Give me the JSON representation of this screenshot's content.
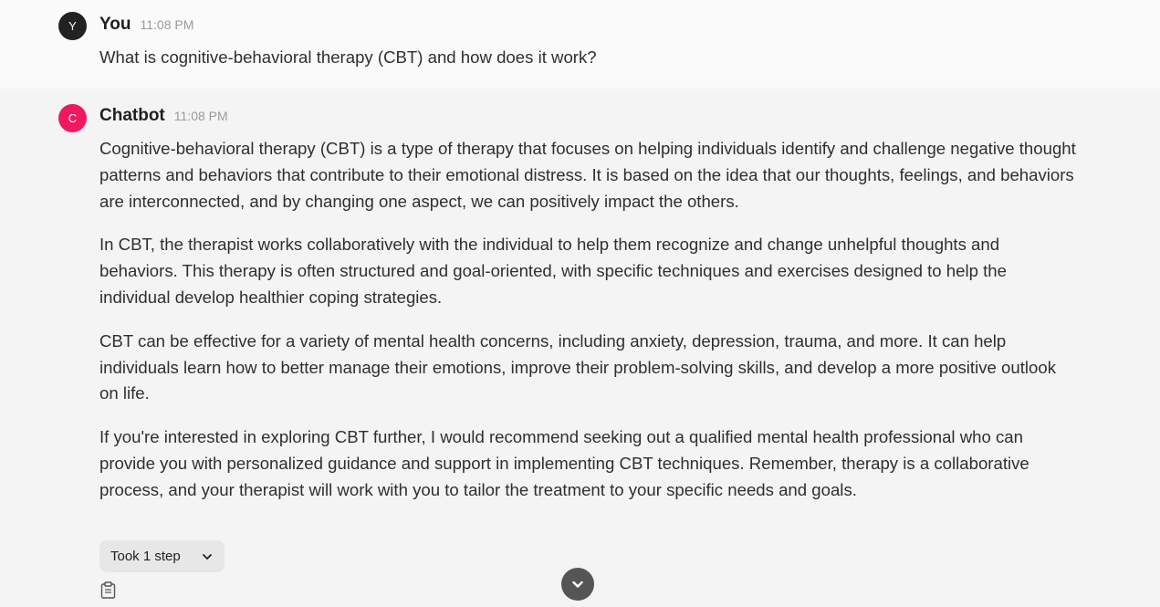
{
  "messages": {
    "user": {
      "avatar_letter": "Y",
      "name": "You",
      "time": "11:08 PM",
      "text": "What is cognitive-behavioral therapy (CBT) and how does it work?"
    },
    "bot": {
      "avatar_letter": "C",
      "name": "Chatbot",
      "time": "11:08 PM",
      "paragraphs": [
        "Cognitive-behavioral therapy (CBT) is a type of therapy that focuses on helping individuals identify and challenge negative thought patterns and behaviors that contribute to their emotional distress. It is based on the idea that our thoughts, feelings, and behaviors are interconnected, and by changing one aspect, we can positively impact the others.",
        "In CBT, the therapist works collaboratively with the individual to help them recognize and change unhelpful thoughts and behaviors. This therapy is often structured and goal-oriented, with specific techniques and exercises designed to help the individual develop healthier coping strategies.",
        "CBT can be effective for a variety of mental health concerns, including anxiety, depression, trauma, and more. It can help individuals learn how to better manage their emotions, improve their problem-solving skills, and develop a more positive outlook on life.",
        "If you're interested in exploring CBT further, I would recommend seeking out a qualified mental health professional who can provide you with personalized guidance and support in implementing CBT techniques. Remember, therapy is a collaborative process, and your therapist will work with you to tailor the treatment to your specific needs and goals."
      ],
      "steps_label": "Took 1 step"
    }
  },
  "icons": {
    "steps_toggle": "chevron-down-icon",
    "copy": "clipboard-icon",
    "scroll": "chevron-down-circle-icon"
  },
  "colors": {
    "user_avatar": "#222222",
    "bot_avatar": "#f0195f",
    "user_bg": "#fafafa",
    "bot_bg": "#f4f4f4"
  }
}
